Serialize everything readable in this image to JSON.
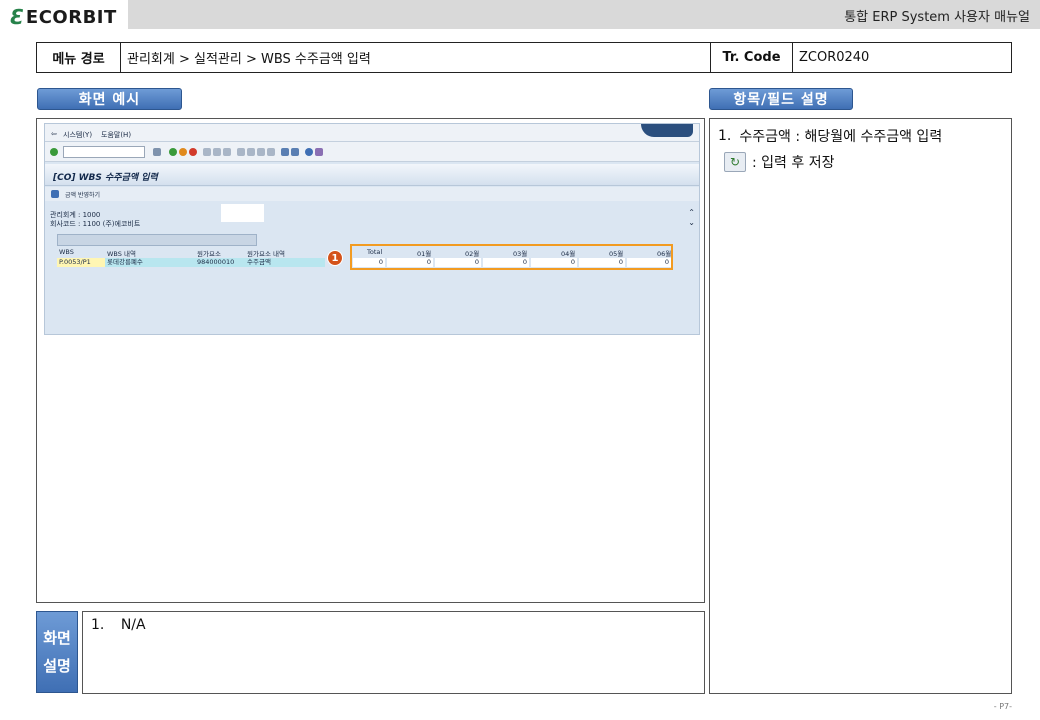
{
  "header": {
    "logo_text": "ECORBIT",
    "doc_title": "통합 ERP System 사용자 매뉴얼"
  },
  "menu_table": {
    "path_label": "메뉴 경로",
    "path_value": "관리회계 > 실적관리 > WBS 수주금액 입력",
    "code_label": "Tr. Code",
    "code_value": "ZCOR0240"
  },
  "sections": {
    "screen_example": "화면 예시",
    "field_desc": "항목/필드 설명",
    "screen_desc_line1": "화면",
    "screen_desc_line2": "설명"
  },
  "field_descriptions": [
    {
      "num": "1.",
      "text": "수주금액 : 해당월에 수주금액 입력"
    },
    {
      "num": "",
      "text": ": 입력 후 저장"
    }
  ],
  "screen_description": [
    {
      "num": "1.",
      "text": "N/A"
    }
  ],
  "page_number": "- P7-",
  "sap": {
    "menu": [
      "시스템(Y)",
      "도움말(H)"
    ],
    "title": "[CO] WBS 수주금액 입력",
    "app_button": "금액 반영하기",
    "header_lines": [
      "관리회계 : 1000",
      "회사코드 : 1100 (주)에코비트"
    ],
    "grid_headers": [
      "WBS",
      "WBS 내역",
      "원가요소",
      "원가요소 내역",
      "Total",
      "01월",
      "02월",
      "03월",
      "04월",
      "05월",
      "06월"
    ],
    "row": {
      "wbs": "P.0053/P1",
      "wbs_desc": "롯데강릉폐수",
      "cost_elem": "984000010",
      "cost_desc": "수주금액",
      "values": [
        "0",
        "0",
        "0",
        "0",
        "0",
        "0",
        "0"
      ]
    },
    "marker": "1"
  },
  "colors": {
    "tab_blue": "#4a7bc0",
    "highlight_orange": "#f29b21",
    "marker_red": "#d4531b",
    "logo_green": "#27824a"
  }
}
